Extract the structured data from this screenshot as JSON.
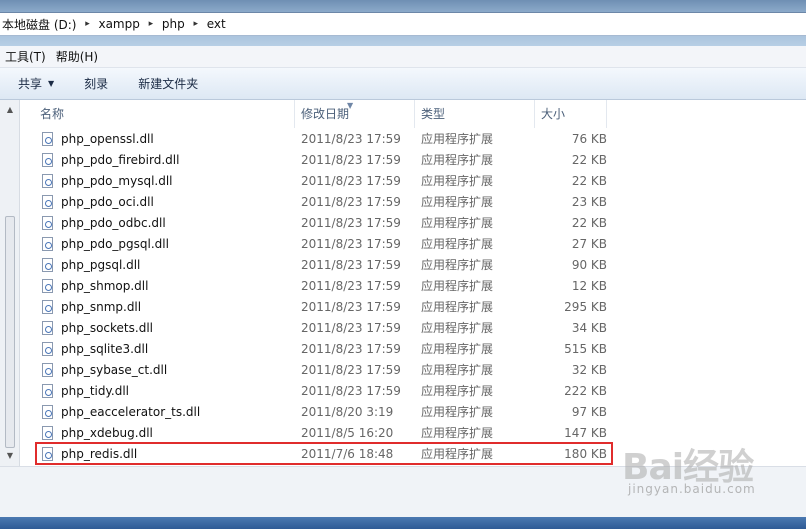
{
  "address": {
    "breadcrumbs": [
      "本地磁盘 (D:)",
      "xampp",
      "php",
      "ext"
    ]
  },
  "menu": [
    "工具(T)",
    "帮助(H)"
  ],
  "toolbar": {
    "share_label": "共享",
    "burn_label": "刻录",
    "new_folder_label": "新建文件夹"
  },
  "columns": {
    "name": "名称",
    "date": "修改日期",
    "type": "类型",
    "size": "大小"
  },
  "files": [
    {
      "name": "php_openssl.dll",
      "date": "2011/8/23 17:59",
      "type": "应用程序扩展",
      "size": "76 KB"
    },
    {
      "name": "php_pdo_firebird.dll",
      "date": "2011/8/23 17:59",
      "type": "应用程序扩展",
      "size": "22 KB"
    },
    {
      "name": "php_pdo_mysql.dll",
      "date": "2011/8/23 17:59",
      "type": "应用程序扩展",
      "size": "22 KB"
    },
    {
      "name": "php_pdo_oci.dll",
      "date": "2011/8/23 17:59",
      "type": "应用程序扩展",
      "size": "23 KB"
    },
    {
      "name": "php_pdo_odbc.dll",
      "date": "2011/8/23 17:59",
      "type": "应用程序扩展",
      "size": "22 KB"
    },
    {
      "name": "php_pdo_pgsql.dll",
      "date": "2011/8/23 17:59",
      "type": "应用程序扩展",
      "size": "27 KB"
    },
    {
      "name": "php_pgsql.dll",
      "date": "2011/8/23 17:59",
      "type": "应用程序扩展",
      "size": "90 KB"
    },
    {
      "name": "php_shmop.dll",
      "date": "2011/8/23 17:59",
      "type": "应用程序扩展",
      "size": "12 KB"
    },
    {
      "name": "php_snmp.dll",
      "date": "2011/8/23 17:59",
      "type": "应用程序扩展",
      "size": "295 KB"
    },
    {
      "name": "php_sockets.dll",
      "date": "2011/8/23 17:59",
      "type": "应用程序扩展",
      "size": "34 KB"
    },
    {
      "name": "php_sqlite3.dll",
      "date": "2011/8/23 17:59",
      "type": "应用程序扩展",
      "size": "515 KB"
    },
    {
      "name": "php_sybase_ct.dll",
      "date": "2011/8/23 17:59",
      "type": "应用程序扩展",
      "size": "32 KB"
    },
    {
      "name": "php_tidy.dll",
      "date": "2011/8/23 17:59",
      "type": "应用程序扩展",
      "size": "222 KB"
    },
    {
      "name": "php_eaccelerator_ts.dll",
      "date": "2011/8/20 3:19",
      "type": "应用程序扩展",
      "size": "97 KB"
    },
    {
      "name": "php_xdebug.dll",
      "date": "2011/8/5 16:20",
      "type": "应用程序扩展",
      "size": "147 KB"
    },
    {
      "name": "php_redis.dll",
      "date": "2011/7/6 18:48",
      "type": "应用程序扩展",
      "size": "180 KB",
      "highlighted": true
    }
  ],
  "watermark": {
    "logo": "Bai经验",
    "url": "jingyan.baidu.com"
  },
  "colors": {
    "highlight_border": "#e02c2c",
    "header_text": "#4c607a"
  },
  "icons": {
    "file": "dll-file-icon",
    "dropdown": "caret-down-icon",
    "scroll_up": "scroll-up-icon",
    "scroll_down": "scroll-down-icon"
  }
}
